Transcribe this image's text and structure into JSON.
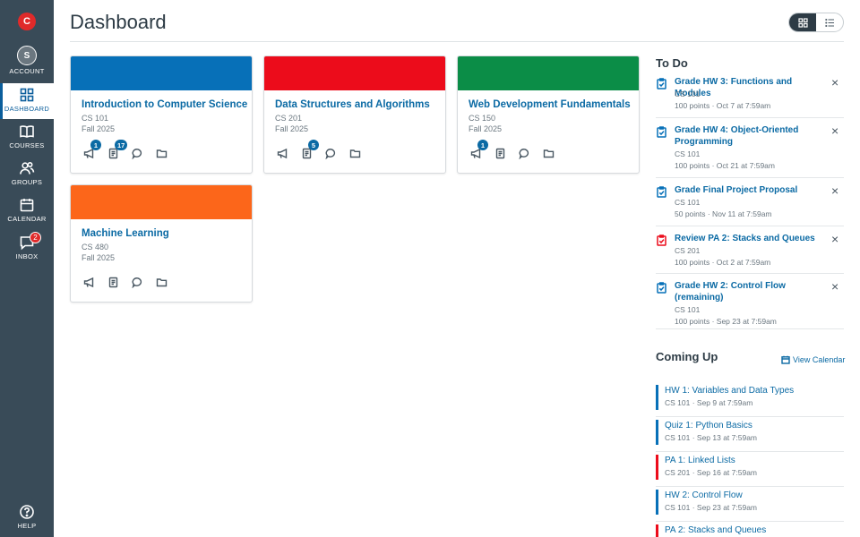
{
  "app": {
    "logo_letter": "C"
  },
  "nav": {
    "account": {
      "label": "ACCOUNT",
      "avatar": "S"
    },
    "dashboard": {
      "label": "DASHBOARD"
    },
    "courses": {
      "label": "COURSES"
    },
    "groups": {
      "label": "GROUPS"
    },
    "calendar": {
      "label": "CALENDAR"
    },
    "inbox": {
      "label": "INBOX",
      "badge": "2"
    },
    "help": {
      "label": "HELP"
    }
  },
  "header": {
    "title": "Dashboard"
  },
  "courses": [
    {
      "title": "Introduction to Computer Science",
      "code": "CS 101",
      "term": "Fall 2025",
      "color": "#0770b8",
      "badges": {
        "announcements": "1",
        "assignments": "17",
        "discussions": "",
        "files": ""
      }
    },
    {
      "title": "Data Structures and Algorithms",
      "code": "CS 201",
      "term": "Fall 2025",
      "color": "#ec0c1b",
      "badges": {
        "announcements": "",
        "assignments": "5",
        "discussions": "",
        "files": ""
      }
    },
    {
      "title": "Web Development Fundamentals",
      "code": "CS 150",
      "term": "Fall 2025",
      "color": "#0b8d47",
      "badges": {
        "announcements": "1",
        "assignments": "",
        "discussions": "",
        "files": ""
      }
    },
    {
      "title": "Machine Learning",
      "code": "CS 480",
      "term": "Fall 2025",
      "color": "#fc661a",
      "badges": {
        "announcements": "",
        "assignments": "",
        "discussions": "",
        "files": ""
      }
    }
  ],
  "todo": {
    "title": "To Do",
    "items": [
      {
        "title": "Grade HW 3: Functions and Modules",
        "course": "CS 101",
        "details": "100 points · Oct 7 at 7:59am",
        "icon_color": "#0770b8"
      },
      {
        "title": "Grade HW 4: Object-Oriented Programming",
        "course": "CS 101",
        "details": "100 points · Oct 21 at 7:59am",
        "icon_color": "#0770b8"
      },
      {
        "title": "Grade Final Project Proposal",
        "course": "CS 101",
        "details": "50 points · Nov 11 at 7:59am",
        "icon_color": "#0770b8"
      },
      {
        "title": "Review PA 2: Stacks and Queues",
        "course": "CS 201",
        "details": "100 points · Oct 2 at 7:59am",
        "icon_color": "#ec0c1b"
      },
      {
        "title": "Grade HW 2: Control Flow (remaining)",
        "course": "CS 101",
        "details": "100 points · Sep 23 at 7:59am",
        "icon_color": "#0770b8"
      }
    ],
    "close_glyph": "×"
  },
  "coming_up": {
    "title": "Coming Up",
    "view_calendar": "View Calendar",
    "items": [
      {
        "title": "HW 1: Variables and Data Types",
        "meta": "CS 101 · Sep 9 at 7:59am",
        "color": "#0770b8"
      },
      {
        "title": "Quiz 1: Python Basics",
        "meta": "CS 101 · Sep 13 at 7:59am",
        "color": "#0770b8"
      },
      {
        "title": "PA 1: Linked Lists",
        "meta": "CS 201 · Sep 16 at 7:59am",
        "color": "#ec0c1b"
      },
      {
        "title": "HW 2: Control Flow",
        "meta": "CS 101 · Sep 23 at 7:59am",
        "color": "#0770b8"
      },
      {
        "title": "PA 2: Stacks and Queues",
        "meta": "",
        "color": "#ec0c1b"
      }
    ]
  }
}
